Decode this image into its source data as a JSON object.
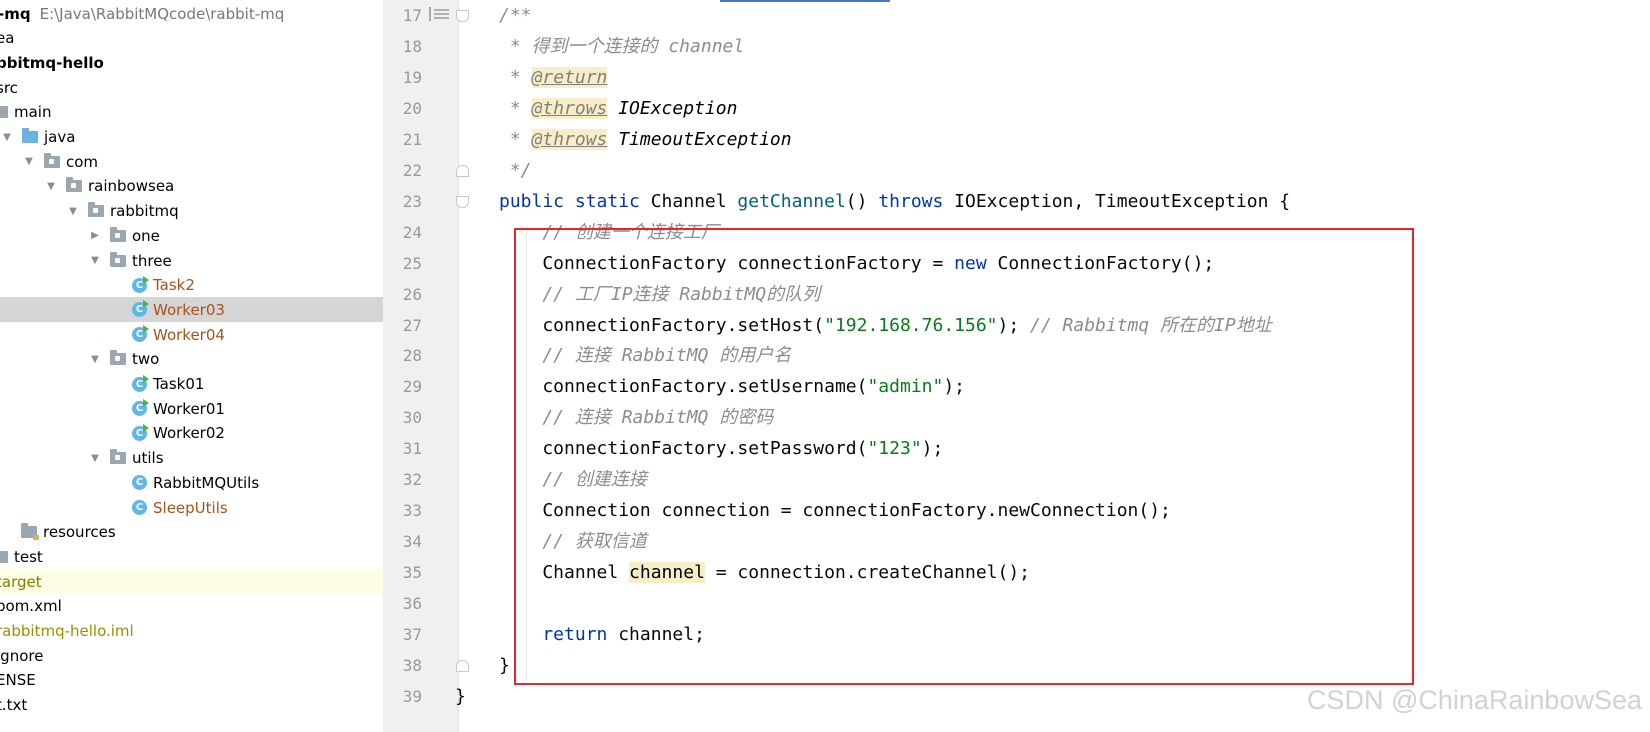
{
  "tree": {
    "rows": [
      {
        "kind": "root",
        "name": "-mq",
        "path": "E:\\Java\\RabbitMQcode\\rabbit-mq",
        "indent": -2,
        "bold": true
      },
      {
        "kind": "text",
        "name": "ea",
        "indent": -4
      },
      {
        "kind": "text",
        "name": "bbitmq-hello",
        "indent": -4,
        "bold": true
      },
      {
        "kind": "text",
        "name": "src",
        "indent": -4
      },
      {
        "kind": "folder",
        "name": "main",
        "indent": 0,
        "color": "gray"
      },
      {
        "kind": "folder",
        "name": "java",
        "indent": 1,
        "arrow": "open",
        "color": "blue"
      },
      {
        "kind": "folder",
        "name": "com",
        "indent": 2,
        "arrow": "open",
        "color": "pkg"
      },
      {
        "kind": "folder",
        "name": "rainbowsea",
        "indent": 3,
        "arrow": "open",
        "color": "pkg"
      },
      {
        "kind": "folder",
        "name": "rabbitmq",
        "indent": 4,
        "arrow": "open",
        "color": "pkg"
      },
      {
        "kind": "folder",
        "name": "one",
        "indent": 5,
        "arrow": "closed",
        "color": "pkg"
      },
      {
        "kind": "folder",
        "name": "three",
        "indent": 5,
        "arrow": "open",
        "color": "pkg"
      },
      {
        "kind": "class",
        "name": "Task2",
        "indent": 6,
        "runnable": true,
        "color": "orange"
      },
      {
        "kind": "class",
        "name": "Worker03",
        "indent": 6,
        "runnable": true,
        "color": "orange",
        "selected": true
      },
      {
        "kind": "class",
        "name": "Worker04",
        "indent": 6,
        "runnable": true,
        "color": "orange"
      },
      {
        "kind": "folder",
        "name": "two",
        "indent": 5,
        "arrow": "open",
        "color": "pkg"
      },
      {
        "kind": "class",
        "name": "Task01",
        "indent": 6,
        "runnable": true
      },
      {
        "kind": "class",
        "name": "Worker01",
        "indent": 6,
        "runnable": true
      },
      {
        "kind": "class",
        "name": "Worker02",
        "indent": 6,
        "runnable": true
      },
      {
        "kind": "folder",
        "name": "utils",
        "indent": 5,
        "arrow": "open",
        "color": "pkg"
      },
      {
        "kind": "class",
        "name": "RabbitMQUtils",
        "indent": 6
      },
      {
        "kind": "class",
        "name": "SleepUtils",
        "indent": 6,
        "color": "orange"
      },
      {
        "kind": "folder",
        "name": "resources",
        "indent": 1,
        "color": "res"
      },
      {
        "kind": "folder",
        "name": "test",
        "indent": 0,
        "color": "gray"
      },
      {
        "kind": "text",
        "name": "target",
        "indent": -4,
        "color": "olive",
        "highlight": true
      },
      {
        "kind": "text",
        "name": "pom.xml",
        "indent": -4
      },
      {
        "kind": "text",
        "name": "rabbitmq-hello.iml",
        "indent": -4,
        "color": "olive-lite"
      },
      {
        "kind": "text",
        "name": "ignore",
        "indent": -4
      },
      {
        "kind": "text",
        "name": "ENSE",
        "indent": -4
      },
      {
        "kind": "text",
        "name": "t.txt",
        "indent": -4
      }
    ]
  },
  "editor": {
    "first_line": 17,
    "lines": [
      [
        [
          "comment",
          "/**"
        ]
      ],
      [
        [
          "comment",
          " * 得到一个连接的 channel"
        ]
      ],
      [
        [
          "comment",
          " * "
        ],
        [
          "doctag",
          "@return"
        ]
      ],
      [
        [
          "comment",
          " * "
        ],
        [
          "doctag",
          "@throws"
        ],
        [
          "docref",
          " IOException"
        ]
      ],
      [
        [
          "comment",
          " * "
        ],
        [
          "doctag",
          "@throws"
        ],
        [
          "docref",
          " TimeoutException"
        ]
      ],
      [
        [
          "comment",
          " */"
        ]
      ],
      [
        [
          "kw",
          "public static "
        ],
        [
          "plain",
          "Channel "
        ],
        [
          "fn",
          "getChannel"
        ],
        [
          "plain",
          "() "
        ],
        [
          "kw",
          "throws "
        ],
        [
          "plain",
          "IOException, TimeoutException {"
        ]
      ],
      [
        [
          "comment",
          "    // 创建一个连接工厂"
        ]
      ],
      [
        [
          "plain",
          "    ConnectionFactory connectionFactory = "
        ],
        [
          "kw",
          "new "
        ],
        [
          "plain",
          "ConnectionFactory();"
        ]
      ],
      [
        [
          "comment",
          "    // 工厂IP连接 RabbitMQ的队列"
        ]
      ],
      [
        [
          "plain",
          "    connectionFactory.setHost("
        ],
        [
          "str",
          "\"192.168.76.156\""
        ],
        [
          "plain",
          "); "
        ],
        [
          "comment",
          "// Rabbitmq 所在的IP地址"
        ]
      ],
      [
        [
          "comment",
          "    // 连接 RabbitMQ 的用户名"
        ]
      ],
      [
        [
          "plain",
          "    connectionFactory.setUsername("
        ],
        [
          "str",
          "\"admin\""
        ],
        [
          "plain",
          ");"
        ]
      ],
      [
        [
          "comment",
          "    // 连接 RabbitMQ 的密码"
        ]
      ],
      [
        [
          "plain",
          "    connectionFactory.setPassword("
        ],
        [
          "str",
          "\"123\""
        ],
        [
          "plain",
          ");"
        ]
      ],
      [
        [
          "comment",
          "    // 创建连接"
        ]
      ],
      [
        [
          "plain",
          "    Connection connection = connectionFactory.newConnection();"
        ]
      ],
      [
        [
          "comment",
          "    // 获取信道"
        ]
      ],
      [
        [
          "plain",
          "    Channel "
        ],
        [
          "hl",
          "channel"
        ],
        [
          "plain",
          " = connection.createChannel();"
        ]
      ],
      [],
      [
        [
          "kw",
          "    return "
        ],
        [
          "plain",
          "channel;"
        ]
      ],
      [
        [
          "plain",
          "}"
        ]
      ],
      [
        [
          "plain",
          "}"
        ]
      ]
    ]
  },
  "watermark": "CSDN @ChinaRainbowSea",
  "colors": {
    "keyword": "#0033b3",
    "method": "#00627a",
    "string": "#067d17",
    "comment": "#8c8c8c",
    "highlight_box": "#e5262b",
    "selection": "#d5d5d5"
  }
}
